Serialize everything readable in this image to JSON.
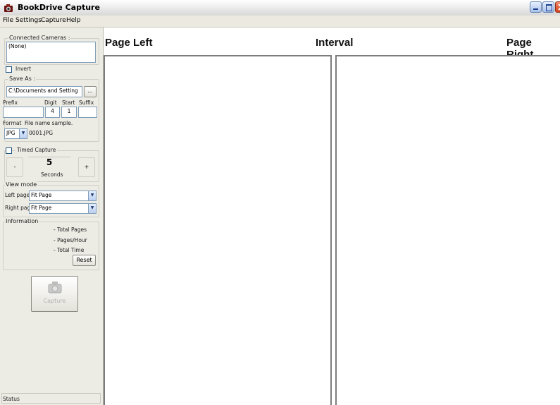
{
  "window": {
    "title": "BookDrive Capture"
  },
  "menu": [
    "File",
    "Settings",
    "Capture",
    "Help"
  ],
  "left_panel": {
    "connected_cameras": {
      "label": "Connected Cameras :",
      "value": "(None)"
    },
    "invert": {
      "label": "Invert",
      "checked": false
    },
    "save_as": {
      "label": "Save As :",
      "path": "C:\\Documents and Setting",
      "browse_label": "...",
      "prefix_label": "Prefix",
      "digit_label": "Digit",
      "start_label": "Start",
      "suffix_label": "Suffix",
      "prefix_value": "",
      "digit_value": "4",
      "start_value": "1",
      "suffix_value": "",
      "format_label": "Format",
      "sample_label": "File name sample.",
      "format_value": "JPG",
      "sample_value": "0001.JPG"
    },
    "timed_capture": {
      "label": "Timed Capture",
      "checked": false,
      "minus_label": "-",
      "plus_label": "+",
      "value": "5",
      "unit": "Seconds"
    },
    "view_mode": {
      "label": "View mode",
      "left_label": "Left page",
      "left_value": "Fit Page",
      "right_label": "Right page",
      "right_value": "Fit Page"
    },
    "information": {
      "label": "Information",
      "total_pages": "-   Total Pages",
      "pages_hour": "-   Pages/Hour",
      "total_time": "-   Total Time",
      "reset_label": "Reset"
    },
    "capture_button_label": "Capture",
    "status_label": "Status"
  },
  "main": {
    "page_left": "Page Left",
    "interval": "Interval",
    "page_right": "Page Right"
  },
  "colors": {
    "panel_bg": "#ecebe4",
    "close_button": "#d1431d",
    "field_border": "#7f9db9"
  },
  "icons": [
    "app-camera-icon",
    "minimize-icon",
    "maximize-icon",
    "close-icon",
    "camera-icon"
  ]
}
